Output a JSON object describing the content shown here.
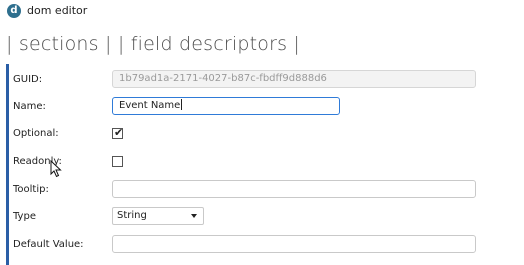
{
  "window": {
    "title": "dom editor",
    "icon": "d-app-icon"
  },
  "breadcrumb": {
    "items": [
      "sections",
      "field descriptors"
    ]
  },
  "form": {
    "guid": {
      "label": "GUID:",
      "value": "1b79ad1a-2171-4027-b87c-fbdff9d888d6",
      "disabled": true
    },
    "name": {
      "label": "Name:",
      "value": "Event Name"
    },
    "optional": {
      "label": "Optional:",
      "checked": true
    },
    "readonly": {
      "label": "Readonly:",
      "checked": false
    },
    "tooltip": {
      "label": "Tooltip:",
      "value": ""
    },
    "type": {
      "label": "Type",
      "selected": "String"
    },
    "default_value": {
      "label": "Default Value:",
      "value": ""
    }
  },
  "colors": {
    "accent_border": "#2a5ea6",
    "focus": "#2f7bd8"
  }
}
